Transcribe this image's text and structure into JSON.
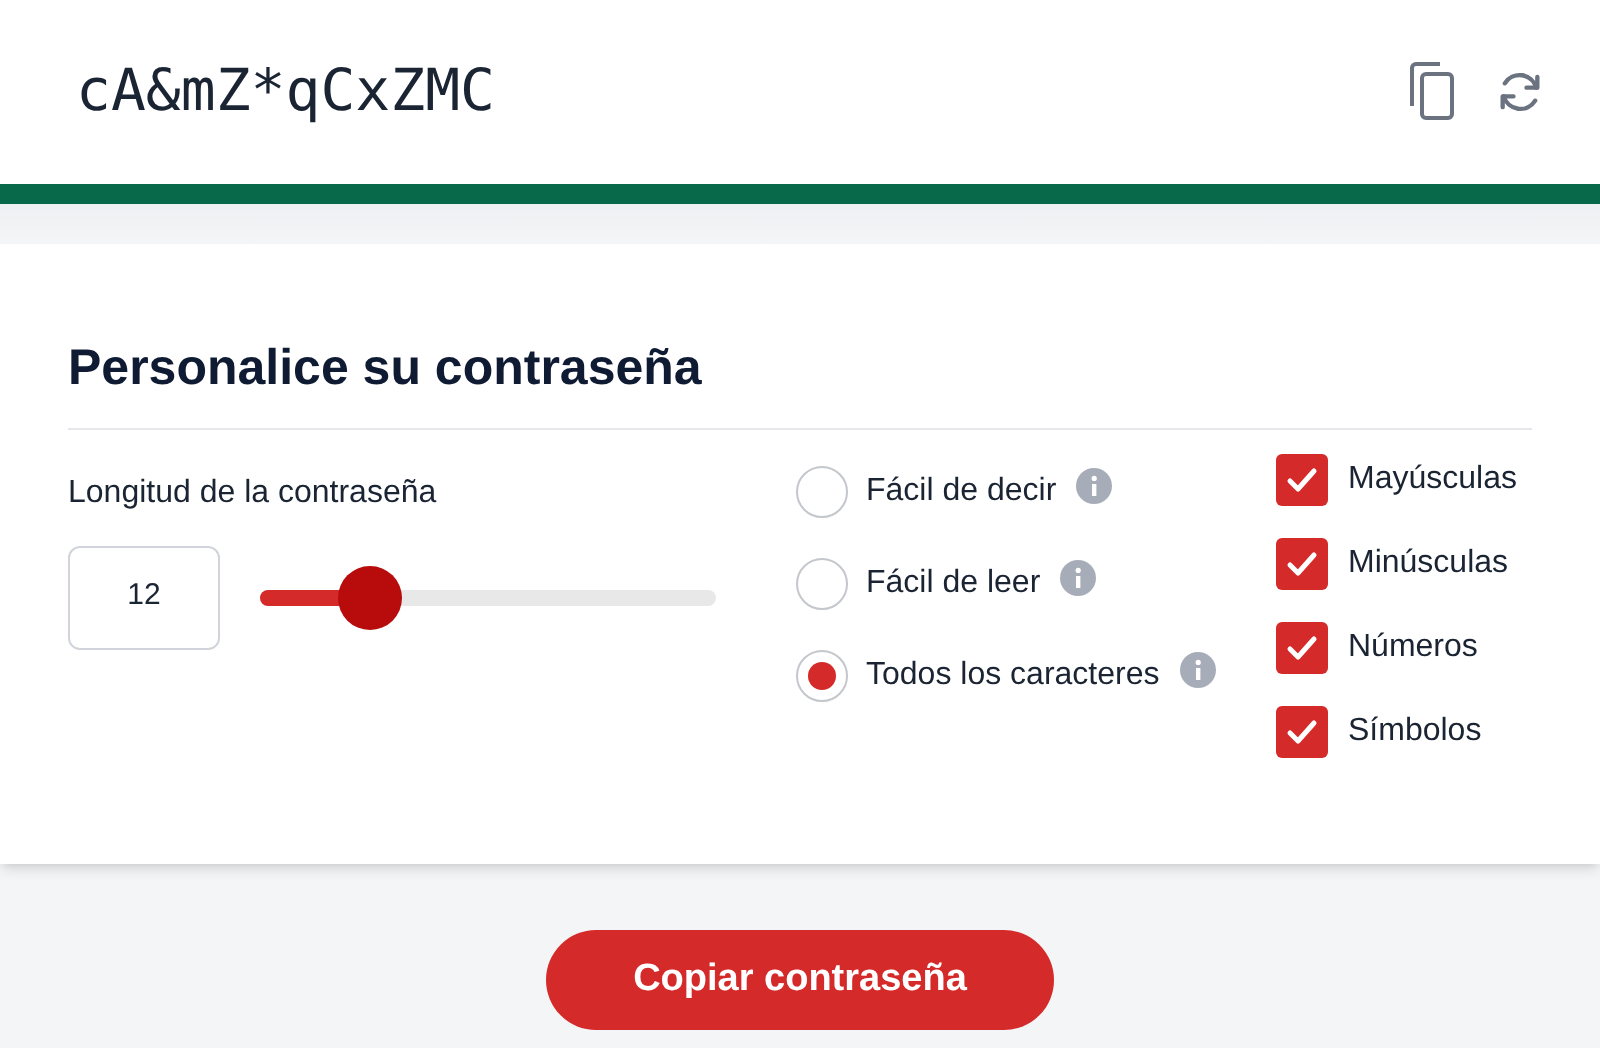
{
  "password": "cA&mZ*qCxZMC",
  "section_title": "Personalice su contraseña",
  "length": {
    "label": "Longitud de la contraseña",
    "value": "12",
    "level": 0.24
  },
  "modes": [
    {
      "label": "Fácil de decir",
      "selected": false
    },
    {
      "label": "Fácil de leer",
      "selected": false
    },
    {
      "label": "Todos los caracteres",
      "selected": true
    }
  ],
  "options": [
    {
      "label": "Mayúsculas",
      "checked": true
    },
    {
      "label": "Minúsculas",
      "checked": true
    },
    {
      "label": "Números",
      "checked": true
    },
    {
      "label": "Símbolos",
      "checked": true
    }
  ],
  "copy_button": "Copiar contraseña"
}
